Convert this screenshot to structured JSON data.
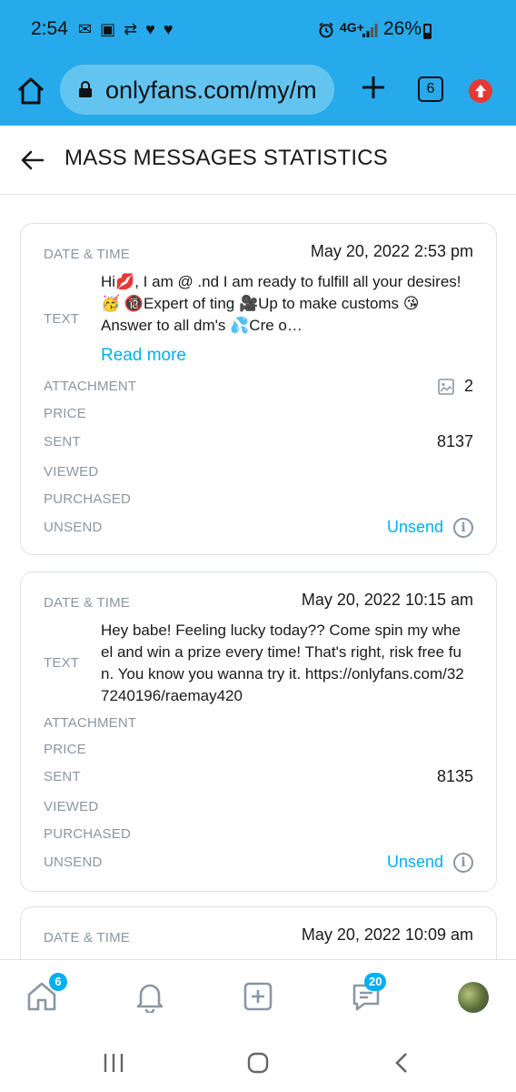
{
  "status_bar": {
    "time": "2:54",
    "left_icons": "✉ ▣ ⇄ ♥ ♥",
    "network": "4G+",
    "battery": "26%"
  },
  "browser": {
    "url": "onlyfans.com/my/m",
    "tab_count": "6"
  },
  "header": {
    "title": "MASS MESSAGES STATISTICS"
  },
  "labels": {
    "date_time": "DATE & TIME",
    "text": "TEXT",
    "attachment": "ATTACHMENT",
    "price": "PRICE",
    "sent": "SENT",
    "viewed": "VIEWED",
    "purchased": "PURCHASED",
    "unsend": "UNSEND",
    "read_more": "Read more",
    "unsend_link": "Unsend",
    "info_icon": "i"
  },
  "cards": [
    {
      "date_time": "May 20, 2022 2:53 pm",
      "text": "Hi💋, I am @                          .nd I am ready to fulfill all your desires!🥳 🔞Expert of         ting 🎥Up to make customs 😘Answer to all dm's 💦Cre      o…",
      "attachment_count": "2",
      "sent": "8137"
    },
    {
      "date_time": "May 20, 2022 10:15 am",
      "text": "Hey babe! Feeling lucky today?? Come spin my wheel and win a prize every time! That's right, risk free fun. You know you wanna try it. https://onlyfans.com/327240196/raemay420",
      "sent": "8135"
    },
    {
      "date_time": "May 20, 2022 10:09 am"
    }
  ],
  "bottom_nav": {
    "home_badge": "6",
    "messages_badge": "20"
  },
  "colors": {
    "browser_bar": "#27aaeb",
    "accent": "#00aff0",
    "label": "#8a96a3"
  }
}
